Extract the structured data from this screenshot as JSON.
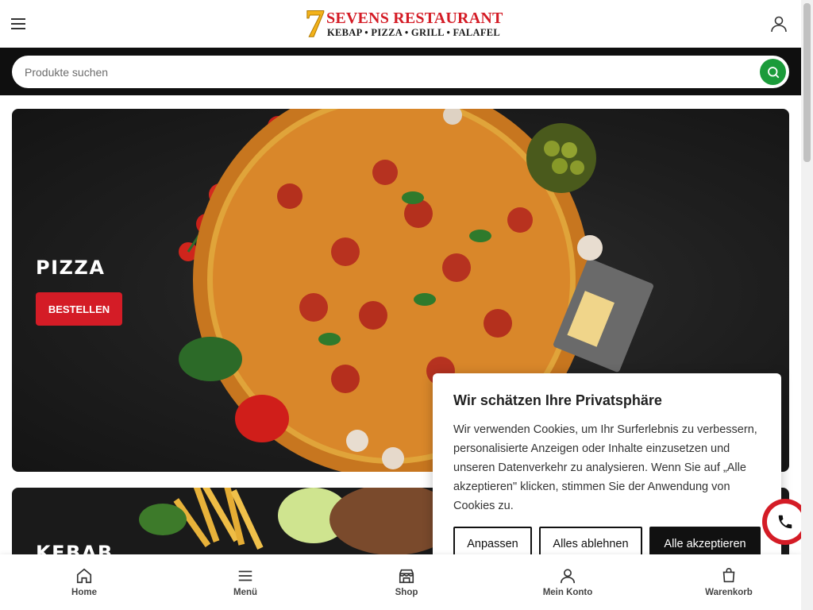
{
  "header": {
    "logo_number": "7",
    "logo_title": "SEVENS RESTAURANT",
    "logo_subtitle": "KEBAP • PIZZA • GRILL • FALAFEL",
    "menu_icon": "hamburger-icon",
    "user_icon": "user-icon"
  },
  "search": {
    "placeholder": "Produkte suchen",
    "button_icon": "search-icon"
  },
  "banners": [
    {
      "title": "PIZZA",
      "button_label": "BESTELLEN"
    },
    {
      "title": "KEBAB"
    }
  ],
  "cookie": {
    "title": "Wir schätzen Ihre Privatsphäre",
    "text": "Wir verwenden Cookies, um Ihr Surferlebnis zu verbessern, personalisierte Anzeigen oder Inhalte einzusetzen und unseren Datenverkehr zu analysieren. Wenn Sie auf „Alle akzeptieren\" klicken, stimmen Sie der Anwendung von Cookies zu.",
    "customize_label": "Anpassen",
    "reject_label": "Alles ablehnen",
    "accept_label": "Alle akzeptieren"
  },
  "bottom_nav": [
    {
      "label": "Home",
      "icon": "home-icon"
    },
    {
      "label": "Menü",
      "icon": "menu-icon"
    },
    {
      "label": "Shop",
      "icon": "store-icon"
    },
    {
      "label": "Mein Konto",
      "icon": "user-icon"
    },
    {
      "label": "Warenkorb",
      "icon": "cart-icon"
    }
  ],
  "colors": {
    "brand_red": "#d41c26",
    "brand_yellow": "#f3b21a",
    "search_green": "#1b9b3a",
    "dark_bg": "#0f0f0f"
  }
}
